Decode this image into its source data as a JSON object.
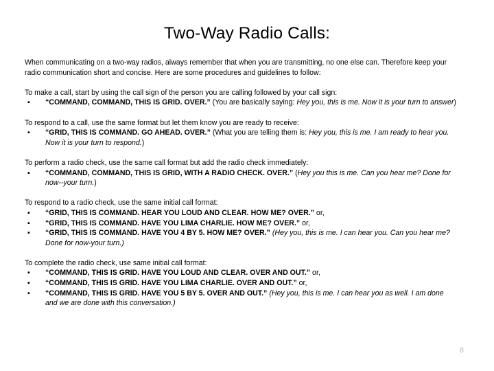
{
  "slide": {
    "title": "Two-Way Radio Calls:",
    "page_number": "8",
    "page_number_color": "#b8b8b8",
    "intro_paragraph": "When communicating on a two-way radios, always remember that when you are transmitting, no one else can.  Therefore keep your radio communication short and concise.   Here are some procedures and guidelines to follow:",
    "sections": [
      {
        "intro": "To make a call,  start by using the call sign of the person you are calling followed by your call sign:",
        "bullets": [
          {
            "bullet_mark": "▪",
            "command": "“COMMAND, COMMAND, THIS IS GRID.  OVER.”",
            "note_prefix": "  (You are basically saying:",
            "note_italic": " Hey you, this is me.  Now it is your turn to answer",
            "note_suffix": ")"
          }
        ]
      },
      {
        "intro": "To respond to a call, use the same format but let them know you are ready to receive:",
        "bullets": [
          {
            "bullet_mark": "▪",
            "command": "“GRID, THIS IS COMMAND.  GO AHEAD. OVER.”",
            "note_prefix": " (What you are telling them is:",
            "note_italic": "  Hey you, this is me.  I am ready to hear you.  Now it is your turn to respond.",
            "note_suffix": ")"
          }
        ]
      },
      {
        "intro": "To perform a radio check, use the same call format but add the radio check immediately:",
        "bullets": [
          {
            "bullet_mark": "▪",
            "command": "“COMMAND, COMMAND, THIS IS GRID, WITH A RADIO CHECK.  OVER.”",
            "note_prefix": "  (",
            "note_italic": "Hey you this is me.  Can you hear me? Done for now--your turn.",
            "note_suffix": ")"
          }
        ]
      },
      {
        "intro": "To respond to a radio check, use the same initial call format:",
        "bullets": [
          {
            "bullet_mark": "▪",
            "command": "“GRID, THIS IS COMMAND.  HEAR YOU LOUD AND CLEAR.  HOW ME? OVER.”",
            "note_prefix": "  or,",
            "note_italic": "",
            "note_suffix": ""
          },
          {
            "bullet_mark": "▪",
            "command": "“GRID, THIS IS COMMAND.  HAVE YOU LIMA CHARLIE.  HOW ME? OVER.”",
            "note_prefix": " or,",
            "note_italic": "",
            "note_suffix": ""
          },
          {
            "bullet_mark": "▪",
            "command": "“GRID, THIS IS COMMAND.  HAVE YOU 4 BY 5. HOW ME? OVER.”",
            "note_prefix": " ",
            "note_italic": "(Hey you, this is me.  I can hear you.  Can you hear me?  Done for now-your turn.)",
            "note_suffix": ""
          }
        ]
      },
      {
        "intro": "To complete the radio check, use same initial call format:",
        "bullets": [
          {
            "bullet_mark": "▪",
            "command": "“COMMAND, THIS IS GRID.  HAVE YOU LOUD AND CLEAR.  OVER AND OUT.”",
            "note_prefix": "  or,",
            "note_italic": "",
            "note_suffix": ""
          },
          {
            "bullet_mark": "▪",
            "command": "“COMMAND, THIS IS GRID.  HAVE YOU LIMA CHARLIE.  OVER AND OUT.”",
            "note_prefix": " or,",
            "note_italic": "",
            "note_suffix": ""
          },
          {
            "bullet_mark": "▪",
            "command": "“COMMAND, THIS IS GRID.  HAVE YOU 5 BY 5.  OVER AND OUT.”",
            "note_prefix": " ",
            "note_italic": "(Hey you, this is me.  I can hear you as well.  I am done and we are done with this conversation.)",
            "note_suffix": ""
          }
        ]
      }
    ]
  }
}
